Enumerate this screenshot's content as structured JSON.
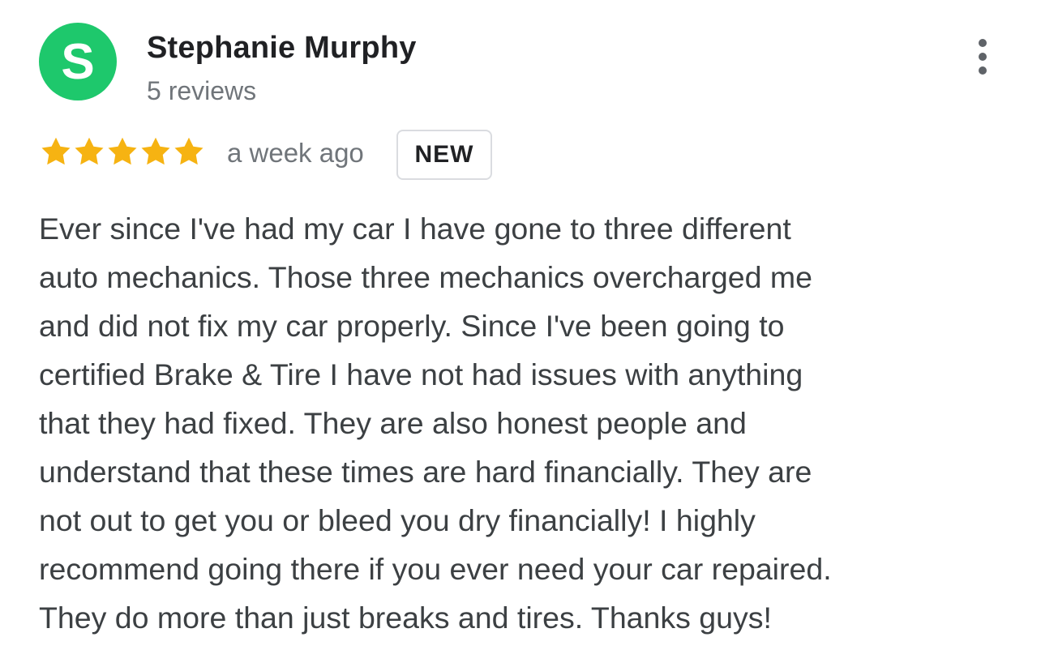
{
  "reviewer": {
    "avatar_letter": "S",
    "avatar_color": "#1ec86c",
    "name": "Stephanie Murphy",
    "review_count": "5 reviews"
  },
  "review": {
    "rating": 5,
    "rating_max": 5,
    "star_color": "#f6b312",
    "date": "a week ago",
    "badge": "NEW",
    "text_lines": [
      "Ever since I've had my car I have gone to three different",
      "auto mechanics. Those three mechanics overcharged me",
      "and did not fix my car properly. Since I've been going to",
      "certified Brake & Tire I have not had issues with anything",
      "that they had fixed. They are also honest people and",
      "understand that these times are hard financially. They are",
      "not out to get you or bleed you dry financially! I highly",
      "recommend going there if you ever need your car repaired.",
      "They do more than just breaks and tires. Thanks guys!"
    ]
  },
  "menu": {
    "icon": "more-vert-icon"
  }
}
